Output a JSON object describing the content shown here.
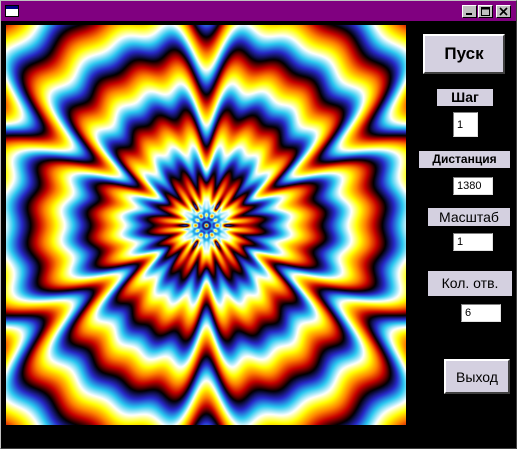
{
  "icons": {
    "system": "window-icon",
    "minimize": "minimize-icon",
    "maximize": "maximize-icon",
    "close": "close-icon"
  },
  "colors": {
    "title_bar": "#800080",
    "background": "#000000",
    "panel": "#d4d0e0"
  },
  "controls": {
    "start_button": "Пуск",
    "step_label": "Шаг",
    "step_value": "1",
    "distance_label": "Дистанция",
    "distance_value": "1380",
    "scale_label": "Масштаб",
    "scale_value": "1",
    "holes_label": "Кол. отв.",
    "holes_value": "6",
    "exit_button": "Выход"
  }
}
